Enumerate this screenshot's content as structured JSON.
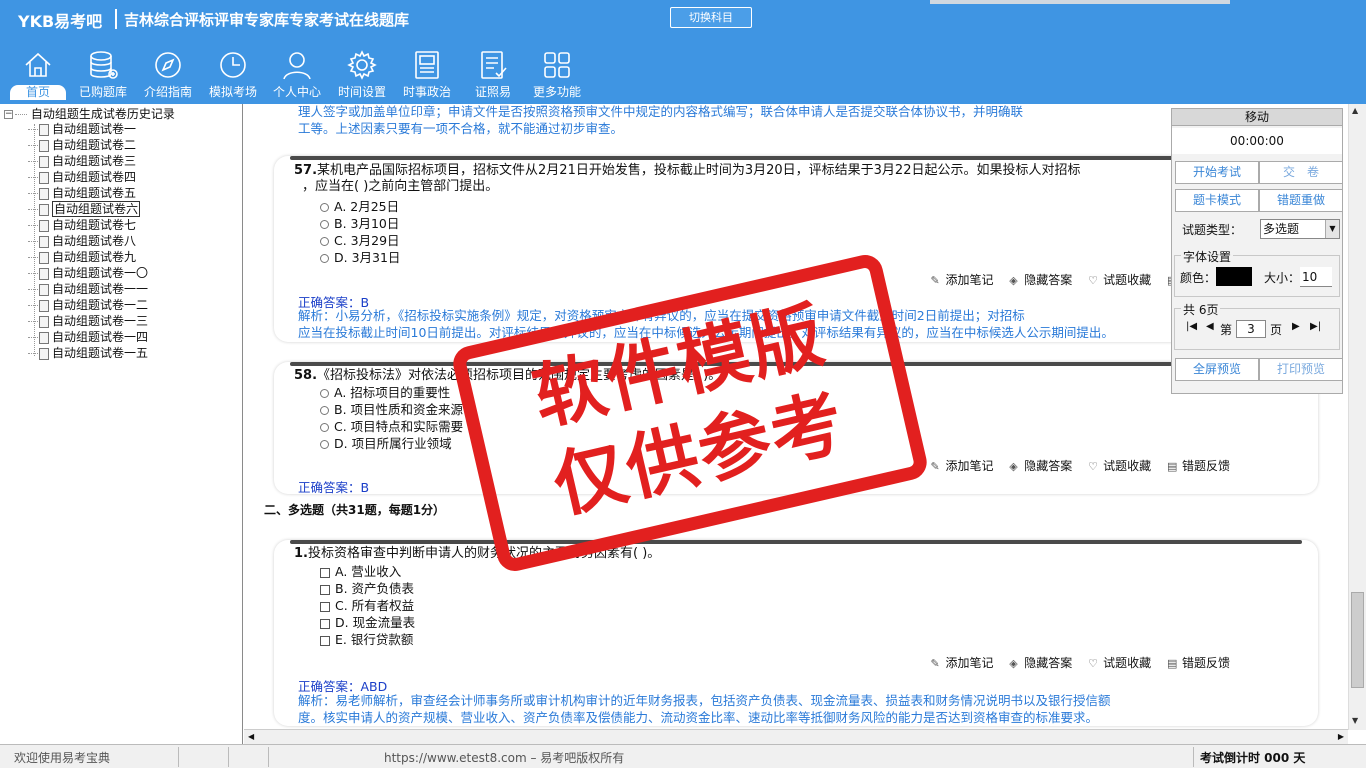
{
  "header": {
    "brand": "YKB易考吧",
    "title": "吉林综合评标评审专家库专家考试在线题库",
    "switch_label": "切换科目"
  },
  "nav": [
    {
      "label": "首页",
      "icon": "home-icon"
    },
    {
      "label": "已购题库",
      "icon": "database-icon"
    },
    {
      "label": "介绍指南",
      "icon": "compass-icon"
    },
    {
      "label": "模拟考场",
      "icon": "clock-icon"
    },
    {
      "label": "个人中心",
      "icon": "user-icon"
    },
    {
      "label": "时间设置",
      "icon": "gear-icon"
    },
    {
      "label": "时事政治",
      "icon": "newspaper-icon"
    },
    {
      "label": "证照易",
      "icon": "checklist-icon"
    },
    {
      "label": "更多功能",
      "icon": "grid-icon"
    }
  ],
  "tree": {
    "root": "自动组题生成试卷历史记录",
    "toggle": "−",
    "items": [
      "自动组题试卷一",
      "自动组题试卷二",
      "自动组题试卷三",
      "自动组题试卷四",
      "自动组题试卷五",
      "自动组题试卷六",
      "自动组题试卷七",
      "自动组题试卷八",
      "自动组题试卷九",
      "自动组题试卷一〇",
      "自动组题试卷一一",
      "自动组题试卷一二",
      "自动组题试卷一三",
      "自动组题试卷一四",
      "自动组题试卷一五"
    ],
    "selected_index": 5
  },
  "prev": {
    "line1": "理人签字或加盖单位印章；申请文件是否按照资格预审文件中规定的内容格式编写；联合体申请人是否提交联合体协议书，并明确联",
    "line2": "工等。上述因素只要有一项不合格，就不能通过初步审查。"
  },
  "q57": {
    "num": "57.",
    "line1": "某机电产品国际招标项目，招标文件从2月21日开始发售，投标截止时间为3月20日，评标结果于3月22日起公示。如果投标人对招标",
    "line2": "，应当在( )之前向主管部门提出。",
    "options": [
      "A. 2月25日",
      "B. 3月10日",
      "C. 3月29日",
      "D. 3月31日"
    ],
    "answer": "正确答案：B",
    "analysis1": "解析：小易分析，《招标投标实施条例》规定，对资格预审文件有异议的，应当在提交资格预审申请文件截止时间2日前提出；对招标",
    "analysis2": "应当在投标截止时间10日前提出。对评标结果有异议的，应当在中标候选人公示期间提出。对评标结果有异议的，应当在中标候选人公示期间提出。"
  },
  "q58": {
    "num": "58.",
    "text": "《招标投标法》对依法必须招标项目的范围规定主要考虑的因素是(  )。",
    "options": [
      "A. 招标项目的重要性",
      "B. 项目性质和资金来源",
      "C. 项目特点和实际需要",
      "D. 项目所属行业领域"
    ],
    "answer": "正确答案：B"
  },
  "section_title": "二、多选题（共31题，每题1分）",
  "m1": {
    "num": "1.",
    "text": "投标资格审查中判断申请人的财务状况的主要财务因素有( )。",
    "options": [
      "A. 营业收入",
      "B. 资产负债表",
      "C. 所有者权益",
      "D. 现金流量表",
      "E. 银行贷款额"
    ],
    "answer": "正确答案：ABD",
    "analysis1": "解析：易老师解析，审查经会计师事务所或审计机构审计的近年财务报表，包括资产负债表、现金流量表、损益表和财务情况说明书以及银行授信额",
    "analysis2": "度。核实申请人的资产规模、营业收入、资产负债率及偿债能力、流动资金比率、速动比率等抵御财务风险的能力是否达到资格审查的标准要求。"
  },
  "actions": {
    "note": "添加笔记",
    "hide": "隐藏答案",
    "fav": "试题收藏",
    "feedback": "错题反馈"
  },
  "panel": {
    "title": "移动",
    "timer": "00:00:00",
    "start": "开始考试",
    "submit": "交　卷",
    "card_mode": "题卡模式",
    "redo": "错题重做",
    "qtype_label": "试题类型：",
    "qtype_value": "多选题",
    "font_group": "字体设置",
    "color_label": "颜色：",
    "size_label": "大小：",
    "size_value": "10",
    "pages_group": "共 6页",
    "page_prefix": "第",
    "page_value": "3",
    "page_suffix": "页",
    "fullscreen": "全屏预览",
    "print": "打印预览",
    "colors": {
      "accent": "#3a86d6",
      "swatch": "#000000"
    }
  },
  "status": {
    "welcome": "欢迎使用易考宝典",
    "copyright": "https://www.etest8.com – 易考吧版权所有",
    "countdown": "考试倒计时 000 天"
  },
  "stamp": {
    "line1": "软件模版",
    "line2": "仅供参考",
    "color": "#e2201f"
  },
  "colors": {
    "header": "#3f95e3",
    "answer": "#1a3ec8",
    "analysis": "#2a7ad8"
  }
}
